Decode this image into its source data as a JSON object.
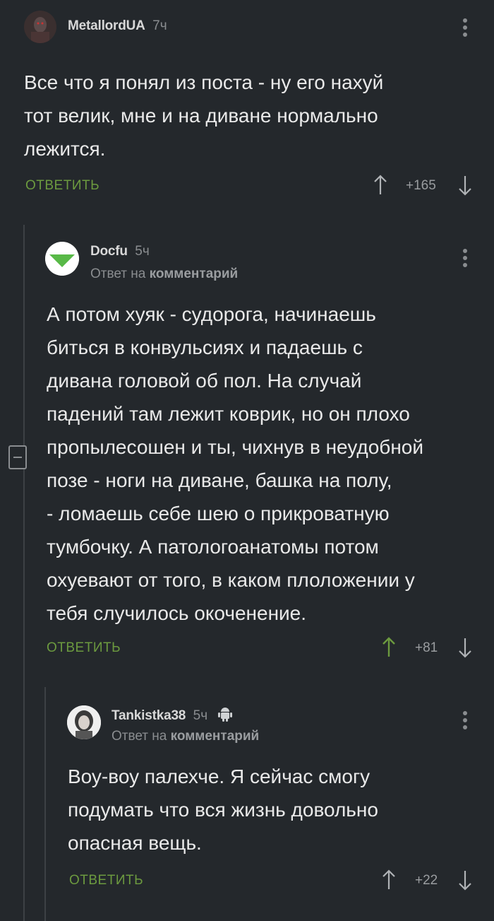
{
  "comments": [
    {
      "user": "MetallordUA",
      "time": "7ч",
      "text_lines": [
        "Все что я понял из поста - ну его нахуй",
        "тот велик, мне и на диване нормально",
        "лежится."
      ],
      "reply_label": "ОТВЕТИТЬ",
      "score": "+165"
    },
    {
      "user": "Docfu",
      "time": "5ч",
      "reply_prefix": "Ответ на",
      "reply_target": "комментарий",
      "text_lines": [
        "А потом хуяк - судорога, начинаешь",
        "биться в конвульсиях и падаешь с",
        "дивана головой об пол. На случай",
        "падений там лежит коврик, но он плохо",
        "пропылесошен и ты, чихнув в неудобной",
        "позе - ноги на диване, башка на полу,",
        "- ломаешь себе шею о прикроватную",
        "тумбочку. А патологоанатомы потом",
        "охуевают от того, в каком плоложении у",
        "тебя случилось окоченение."
      ],
      "reply_label": "ОТВЕТИТЬ",
      "score": "+81"
    },
    {
      "user": "Tankistka38",
      "time": "5ч",
      "reply_prefix": "Ответ на",
      "reply_target": "комментарий",
      "text_lines": [
        "Воу-воу палехче. Я сейчас смогу",
        "подумать что вся жизнь довольно",
        "опасная вещь."
      ],
      "reply_label": "ОТВЕТИТЬ",
      "score": "+22"
    }
  ],
  "colors": {
    "background": "#24282c",
    "accent_green": "#6c9a3f",
    "muted": "#8a8d90"
  },
  "icons": [
    "more-vertical-icon",
    "arrow-up-icon",
    "arrow-down-icon",
    "collapse-minus-icon",
    "android-icon"
  ]
}
